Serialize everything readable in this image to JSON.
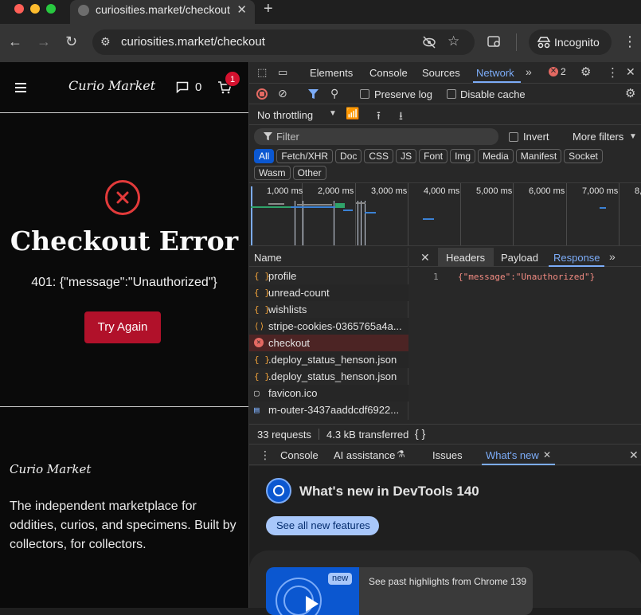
{
  "browser": {
    "tab_title": "curiosities.market/checkout",
    "url": "curiosities.market/checkout",
    "incognito_label": "Incognito"
  },
  "site": {
    "logo": "Curio Market",
    "messages_count": "0",
    "cart_badge": "1",
    "error_title": "Checkout Error",
    "error_message": "401: {\"message\":\"Unauthorized\"}",
    "retry_label": "Try Again",
    "footer_logo": "Curio Market",
    "footer_text": "The independent marketplace for oddities, curios, and specimens. Built by collectors, for collectors."
  },
  "devtools": {
    "tabs": [
      "Elements",
      "Console",
      "Sources",
      "Network"
    ],
    "active_tab": "Network",
    "error_count": "2",
    "preserve_log": "Preserve log",
    "disable_cache": "Disable cache",
    "throttling": "No throttling",
    "filter_placeholder": "Filter",
    "invert": "Invert",
    "more_filters": "More filters",
    "type_filters": [
      "All",
      "Fetch/XHR",
      "Doc",
      "CSS",
      "JS",
      "Font",
      "Img",
      "Media",
      "Manifest",
      "Socket",
      "Wasm",
      "Other"
    ],
    "timeline_ticks": [
      "1,000 ms",
      "2,000 ms",
      "3,000 ms",
      "4,000 ms",
      "5,000 ms",
      "6,000 ms",
      "7,000 ms",
      "8,"
    ],
    "name_header": "Name",
    "requests": [
      {
        "name": "profile",
        "icon": "fetch-icon",
        "selected": false
      },
      {
        "name": "unread-count",
        "icon": "fetch-icon",
        "selected": false
      },
      {
        "name": "wishlists",
        "icon": "fetch-icon",
        "selected": false
      },
      {
        "name": "stripe-cookies-0365765a4a...",
        "icon": "script-icon",
        "selected": false
      },
      {
        "name": "checkout",
        "icon": "error-icon",
        "selected": true
      },
      {
        "name": ".deploy_status_henson.json",
        "icon": "fetch-icon",
        "selected": false
      },
      {
        "name": ".deploy_status_henson.json",
        "icon": "fetch-icon",
        "selected": false
      },
      {
        "name": "favicon.ico",
        "icon": "image-icon",
        "selected": false
      },
      {
        "name": "m-outer-3437aaddcdf6922...",
        "icon": "document-icon",
        "selected": false
      }
    ],
    "detail_tabs": [
      "Headers",
      "Payload",
      "Response"
    ],
    "active_detail_tab": "Response",
    "response_line_number": "1",
    "response_body": "{\"message\":\"Unauthorized\"}",
    "status_requests": "33 requests",
    "status_transferred": "4.3 kB transferred",
    "drawer_tabs": [
      "Console",
      "AI assistance",
      "Issues",
      "What's new"
    ],
    "active_drawer_tab": "What's new",
    "whats_new_title": "What's new in DevTools 140",
    "see_all": "See all new features",
    "new_badge": "new",
    "highlights": "See past highlights from Chrome 139"
  },
  "colors": {
    "accent_blue": "#7cacf8",
    "error_red": "#e23a3a",
    "button_red": "#b1112a"
  }
}
